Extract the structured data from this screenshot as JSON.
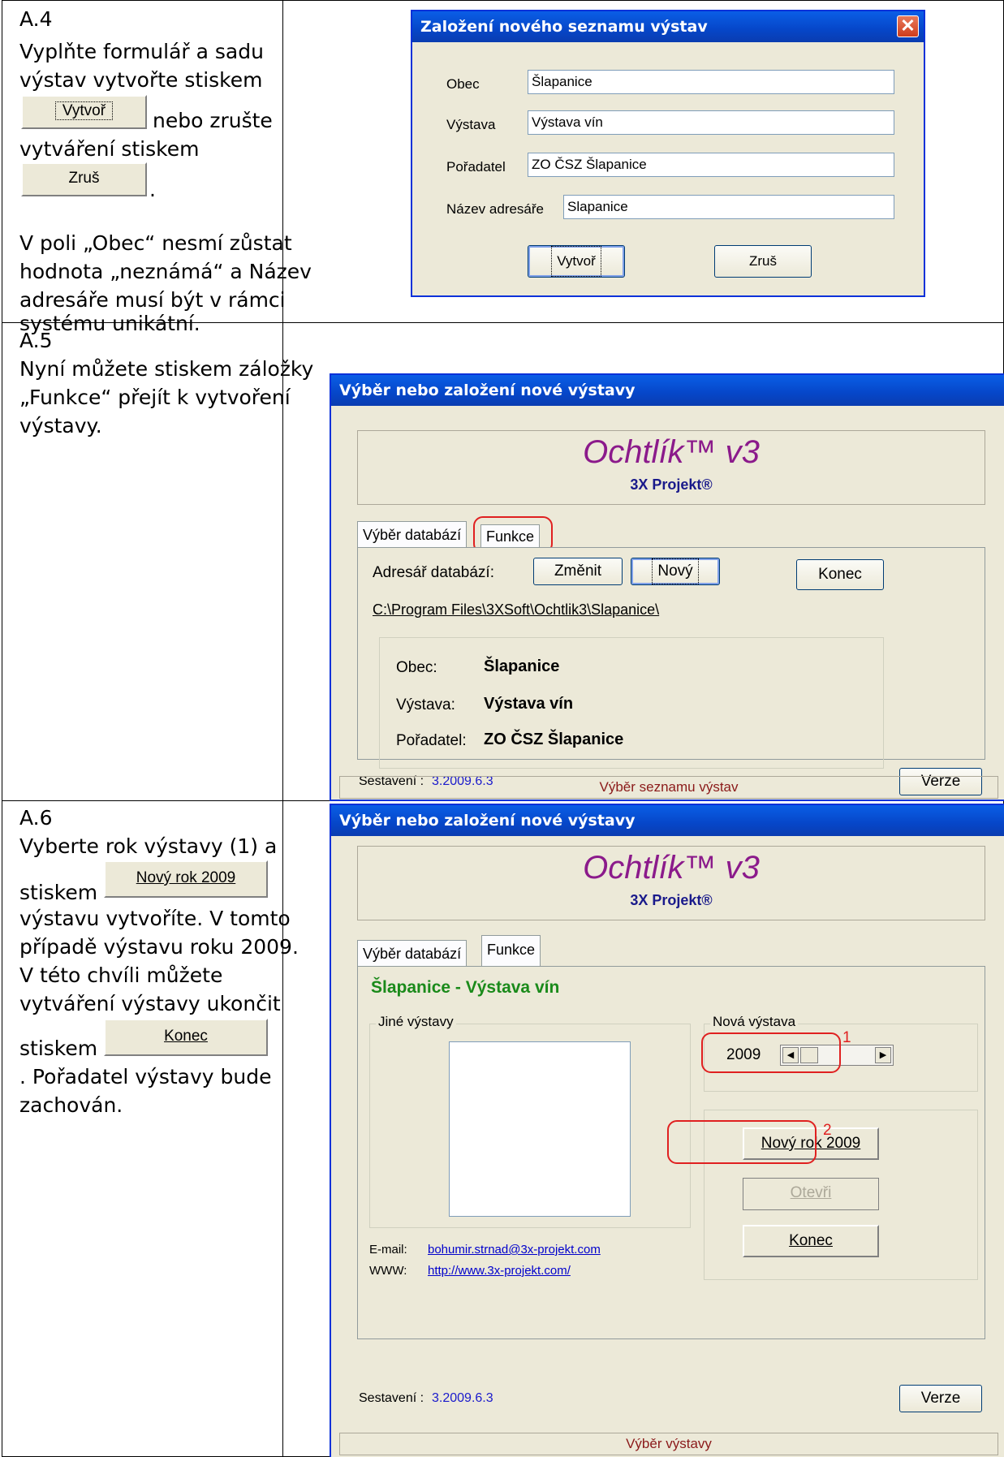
{
  "rows": [
    {
      "id": "A.4",
      "lines": [
        "Vyplňte formulář a sadu",
        "výstav vytvořte stiskem",
        "nebo zrušte",
        "vytváření stiskem",
        ".",
        "V poli „Obec“ nesmí zůstat",
        "hodnota „neznámá“ a Název",
        "adresáře musí být v rámci",
        "systému unikátní."
      ],
      "inline_btn_create": "Vytvoř",
      "inline_btn_cancel": "Zruš"
    },
    {
      "id": "A.5",
      "lines": [
        "Nyní můžete stiskem záložky",
        "„Funkce“ přejít k vytvoření",
        "výstavy."
      ]
    },
    {
      "id": "A.6",
      "lines": [
        "Vyberte rok výstavy (1) a",
        "stiskem",
        "výstavu vytvoříte. V tomto",
        "případě výstavu roku 2009.",
        "V této chvíli můžete",
        "vytváření výstavy ukončit",
        "stiskem",
        ". Pořadatel výstavy bude",
        "zachován."
      ],
      "inline_btn_new_year": "Nový rok 2009",
      "inline_btn_end": "Konec"
    }
  ],
  "dialog1": {
    "title": "Založení nového seznamu výstav",
    "fields": [
      {
        "label": "Obec",
        "value": "Šlapanice"
      },
      {
        "label": "Výstava",
        "value": "Výstava vín"
      },
      {
        "label": "Pořadatel",
        "value": "ZO ČSZ Šlapanice"
      },
      {
        "label": "Název adresáře",
        "value": "Slapanice"
      }
    ],
    "create": "Vytvoř",
    "cancel": "Zruš"
  },
  "dialog2": {
    "title": "Výběr nebo založení nové výstavy",
    "app_name": "Ochtlík™ v3",
    "company": "3X Projekt®",
    "tab1": "Výběr databází",
    "tab2": "Funkce",
    "dir_label": "Adresář databází:",
    "btn_change": "Změnit",
    "btn_new": "Nový",
    "btn_end": "Konec",
    "path": "C:\\Program Files\\3XSoft\\Ochtlik3\\Slapanice\\",
    "info": [
      {
        "label": "Obec:",
        "value": "Šlapanice"
      },
      {
        "label": "Výstava:",
        "value": "Výstava vín"
      },
      {
        "label": "Pořadatel:",
        "value": "ZO ČSZ Šlapanice"
      }
    ],
    "build_label": "Sestavení :",
    "build_value": "3.2009.6.3",
    "btn_version": "Verze",
    "status": "Výběr seznamu výstav",
    "accent_red": "#e02020"
  },
  "dialog3": {
    "title": "Výběr nebo založení nové výstavy",
    "app_name": "Ochtlík™ v3",
    "company": "3X Projekt®",
    "tab1": "Výběr databází",
    "tab2": "Funkce",
    "heading": "Šlapanice - Výstava vín",
    "other_label": "Jiné výstavy",
    "new_label": "Nová výstava",
    "year": "2009",
    "marker1": "1",
    "marker2": "2",
    "btn_new_year": "Nový rok 2009",
    "btn_open": "Otevři",
    "btn_end": "Konec",
    "email_label": "E-mail:",
    "email": "bohumir.strnad@3x-projekt.com",
    "www_label": "WWW:",
    "www": "http://www.3x-projekt.com/",
    "build_label": "Sestavení :",
    "build_value": "3.2009.6.3",
    "btn_version": "Verze",
    "status": "Výběr výstavy",
    "heading_color": "#1a8a1a"
  }
}
